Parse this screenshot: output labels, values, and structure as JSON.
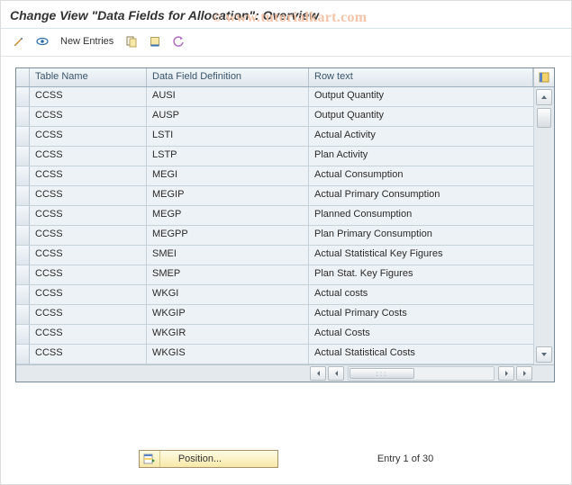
{
  "header": {
    "title": "Change View \"Data Fields for Allocation\": Overview"
  },
  "watermark": {
    "copy": "©",
    "text": "www.tutorialkart.com"
  },
  "toolbar": {
    "new_entries": "New Entries"
  },
  "table": {
    "headers": {
      "table_name": "Table Name",
      "data_field": "Data Field Definition",
      "row_text": "Row text"
    },
    "rows": [
      {
        "table": "CCSS",
        "field": "AUSI",
        "text": "Output Quantity"
      },
      {
        "table": "CCSS",
        "field": "AUSP",
        "text": "Output Quantity"
      },
      {
        "table": "CCSS",
        "field": "LSTI",
        "text": "Actual Activity"
      },
      {
        "table": "CCSS",
        "field": "LSTP",
        "text": "Plan Activity"
      },
      {
        "table": "CCSS",
        "field": "MEGI",
        "text": "Actual Consumption"
      },
      {
        "table": "CCSS",
        "field": "MEGIP",
        "text": "Actual Primary Consumption"
      },
      {
        "table": "CCSS",
        "field": "MEGP",
        "text": "Planned Consumption"
      },
      {
        "table": "CCSS",
        "field": "MEGPP",
        "text": "Plan Primary Consumption"
      },
      {
        "table": "CCSS",
        "field": "SMEI",
        "text": "Actual Statistical Key Figures"
      },
      {
        "table": "CCSS",
        "field": "SMEP",
        "text": "Plan Stat. Key Figures"
      },
      {
        "table": "CCSS",
        "field": "WKGI",
        "text": "Actual costs"
      },
      {
        "table": "CCSS",
        "field": "WKGIP",
        "text": "Actual Primary Costs"
      },
      {
        "table": "CCSS",
        "field": "WKGIR",
        "text": "Actual Costs"
      },
      {
        "table": "CCSS",
        "field": "WKGIS",
        "text": "Actual Statistical Costs"
      }
    ]
  },
  "footer": {
    "position_label": "Position...",
    "entry_text": "Entry 1 of 30"
  }
}
